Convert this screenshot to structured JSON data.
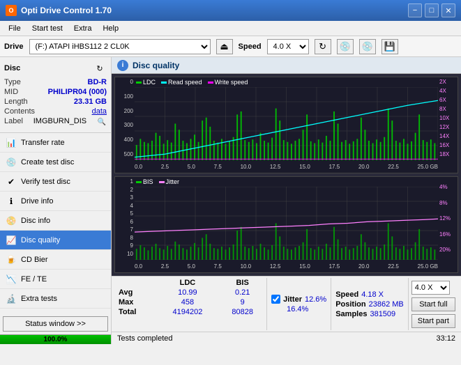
{
  "titlebar": {
    "title": "Opti Drive Control 1.70",
    "icon_text": "O",
    "minimize": "−",
    "maximize": "□",
    "close": "✕"
  },
  "menu": {
    "items": [
      "File",
      "Start test",
      "Extra",
      "Help"
    ]
  },
  "drive_bar": {
    "drive_label": "Drive",
    "drive_value": "(F:)  ATAPI iHBS112  2 CL0K",
    "eject_icon": "⏏",
    "speed_label": "Speed",
    "speed_value": "4.0 X",
    "refresh_icon": "↻",
    "disc_icon1": "💿",
    "disc_icon2": "💿",
    "save_icon": "💾"
  },
  "disc": {
    "label": "Disc",
    "type_key": "Type",
    "type_val": "BD-R",
    "mid_key": "MID",
    "mid_val": "PHILIPR04 (000)",
    "length_key": "Length",
    "length_val": "23.31 GB",
    "contents_key": "Contents",
    "contents_val": "data",
    "label_key": "Label",
    "label_val": "IMGBURN_DIS"
  },
  "sidebar": {
    "items": [
      {
        "id": "transfer-rate",
        "label": "Transfer rate",
        "icon": "📊"
      },
      {
        "id": "create-test-disc",
        "label": "Create test disc",
        "icon": "💿"
      },
      {
        "id": "verify-test-disc",
        "label": "Verify test disc",
        "icon": "✔"
      },
      {
        "id": "drive-info",
        "label": "Drive info",
        "icon": "ℹ"
      },
      {
        "id": "disc-info",
        "label": "Disc info",
        "icon": "📀"
      },
      {
        "id": "disc-quality",
        "label": "Disc quality",
        "icon": "📈",
        "active": true
      },
      {
        "id": "cd-bier",
        "label": "CD Bier",
        "icon": "🍺"
      },
      {
        "id": "fe-te",
        "label": "FE / TE",
        "icon": "📉"
      },
      {
        "id": "extra-tests",
        "label": "Extra tests",
        "icon": "🔬"
      }
    ],
    "status_window_btn": "Status window >>"
  },
  "quality_header": {
    "icon": "i",
    "title": "Disc quality"
  },
  "chart1": {
    "title_ldc": "LDC",
    "title_read": "Read speed",
    "title_write": "Write speed",
    "y_left_labels": [
      "0",
      "100",
      "200",
      "300",
      "400",
      "500"
    ],
    "y_right_labels": [
      "2X",
      "4X",
      "6X",
      "8X",
      "10X",
      "12X",
      "14X",
      "16X",
      "18X"
    ],
    "x_labels": [
      "0.0",
      "2.5",
      "5.0",
      "7.5",
      "10.0",
      "12.5",
      "15.0",
      "17.5",
      "20.0",
      "22.5",
      "25.0 GB"
    ],
    "legend_colors": {
      "ldc": "#00cc00",
      "read": "#00ffff",
      "write": "#ff00ff"
    }
  },
  "chart2": {
    "title_bis": "BIS",
    "title_jitter": "Jitter",
    "y_left_labels": [
      "1",
      "2",
      "3",
      "4",
      "5",
      "6",
      "7",
      "8",
      "9",
      "10"
    ],
    "y_right_labels": [
      "4%",
      "8%",
      "12%",
      "16%",
      "20%"
    ],
    "x_labels": [
      "0.0",
      "2.5",
      "5.0",
      "7.5",
      "10.0",
      "12.5",
      "15.0",
      "17.5",
      "20.0",
      "22.5",
      "25.0 GB"
    ],
    "legend_colors": {
      "bis": "#00cc00",
      "jitter": "#ff80ff"
    }
  },
  "stats": {
    "col_headers": [
      "",
      "LDC",
      "BIS"
    ],
    "rows": [
      {
        "label": "Avg",
        "ldc": "10.99",
        "bis": "0.21"
      },
      {
        "label": "Max",
        "ldc": "458",
        "bis": "9"
      },
      {
        "label": "Total",
        "ldc": "4194202",
        "bis": "80828"
      }
    ],
    "jitter_checked": true,
    "jitter_label": "Jitter",
    "jitter_val": "12.6%",
    "jitter_max_label": "",
    "jitter_max_val": "16.4%",
    "speed_label": "Speed",
    "speed_val": "4.18 X",
    "speed_select": "4.0 X",
    "position_label": "Position",
    "position_val": "23862 MB",
    "samples_label": "Samples",
    "samples_val": "381509",
    "btn_start_full": "Start full",
    "btn_start_part": "Start part"
  },
  "status": {
    "progress": 100,
    "progress_text": "100.0%",
    "status_text": "Tests completed",
    "time": "33:12"
  }
}
